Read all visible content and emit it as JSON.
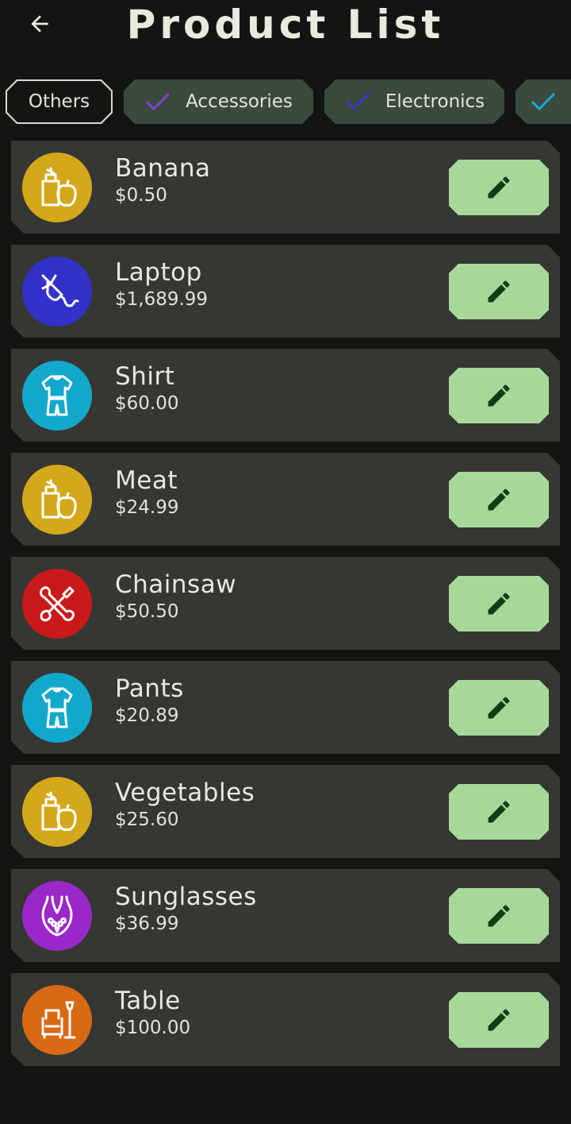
{
  "header": {
    "title": "Product List"
  },
  "chips": [
    {
      "label": "Others",
      "selected": false
    },
    {
      "label": "Accessories",
      "selected": true,
      "check_color": "#8a3ed6"
    },
    {
      "label": "Electronics",
      "selected": true,
      "check_color": "#3a3ac8"
    },
    {
      "label": "",
      "selected": true,
      "check_color": "#22a8d8"
    }
  ],
  "products": [
    {
      "name": "Banana",
      "price": "$0.50",
      "icon": "grocery-bag-icon",
      "color": "#d4a81a"
    },
    {
      "name": "Laptop",
      "price": "$1,689.99",
      "icon": "plug-icon",
      "color": "#3232c8"
    },
    {
      "name": "Shirt",
      "price": "$60.00",
      "icon": "clothes-icon",
      "color": "#12a8cc"
    },
    {
      "name": "Meat",
      "price": "$24.99",
      "icon": "grocery-bag-icon",
      "color": "#d4a81a"
    },
    {
      "name": "Chainsaw",
      "price": "$50.50",
      "icon": "tools-icon",
      "color": "#c81a1a"
    },
    {
      "name": "Pants",
      "price": "$20.89",
      "icon": "clothes-icon",
      "color": "#12a8cc"
    },
    {
      "name": "Vegetables",
      "price": "$25.60",
      "icon": "grocery-bag-icon",
      "color": "#d4a81a"
    },
    {
      "name": "Sunglasses",
      "price": "$36.99",
      "icon": "necklace-icon",
      "color": "#9a28c8"
    },
    {
      "name": "Table",
      "price": "$100.00",
      "icon": "furniture-icon",
      "color": "#d86a14"
    }
  ],
  "colors": {
    "background": "#131512",
    "card": "#353733",
    "edit_button": "#a7d89a",
    "pencil": "#123d14"
  }
}
